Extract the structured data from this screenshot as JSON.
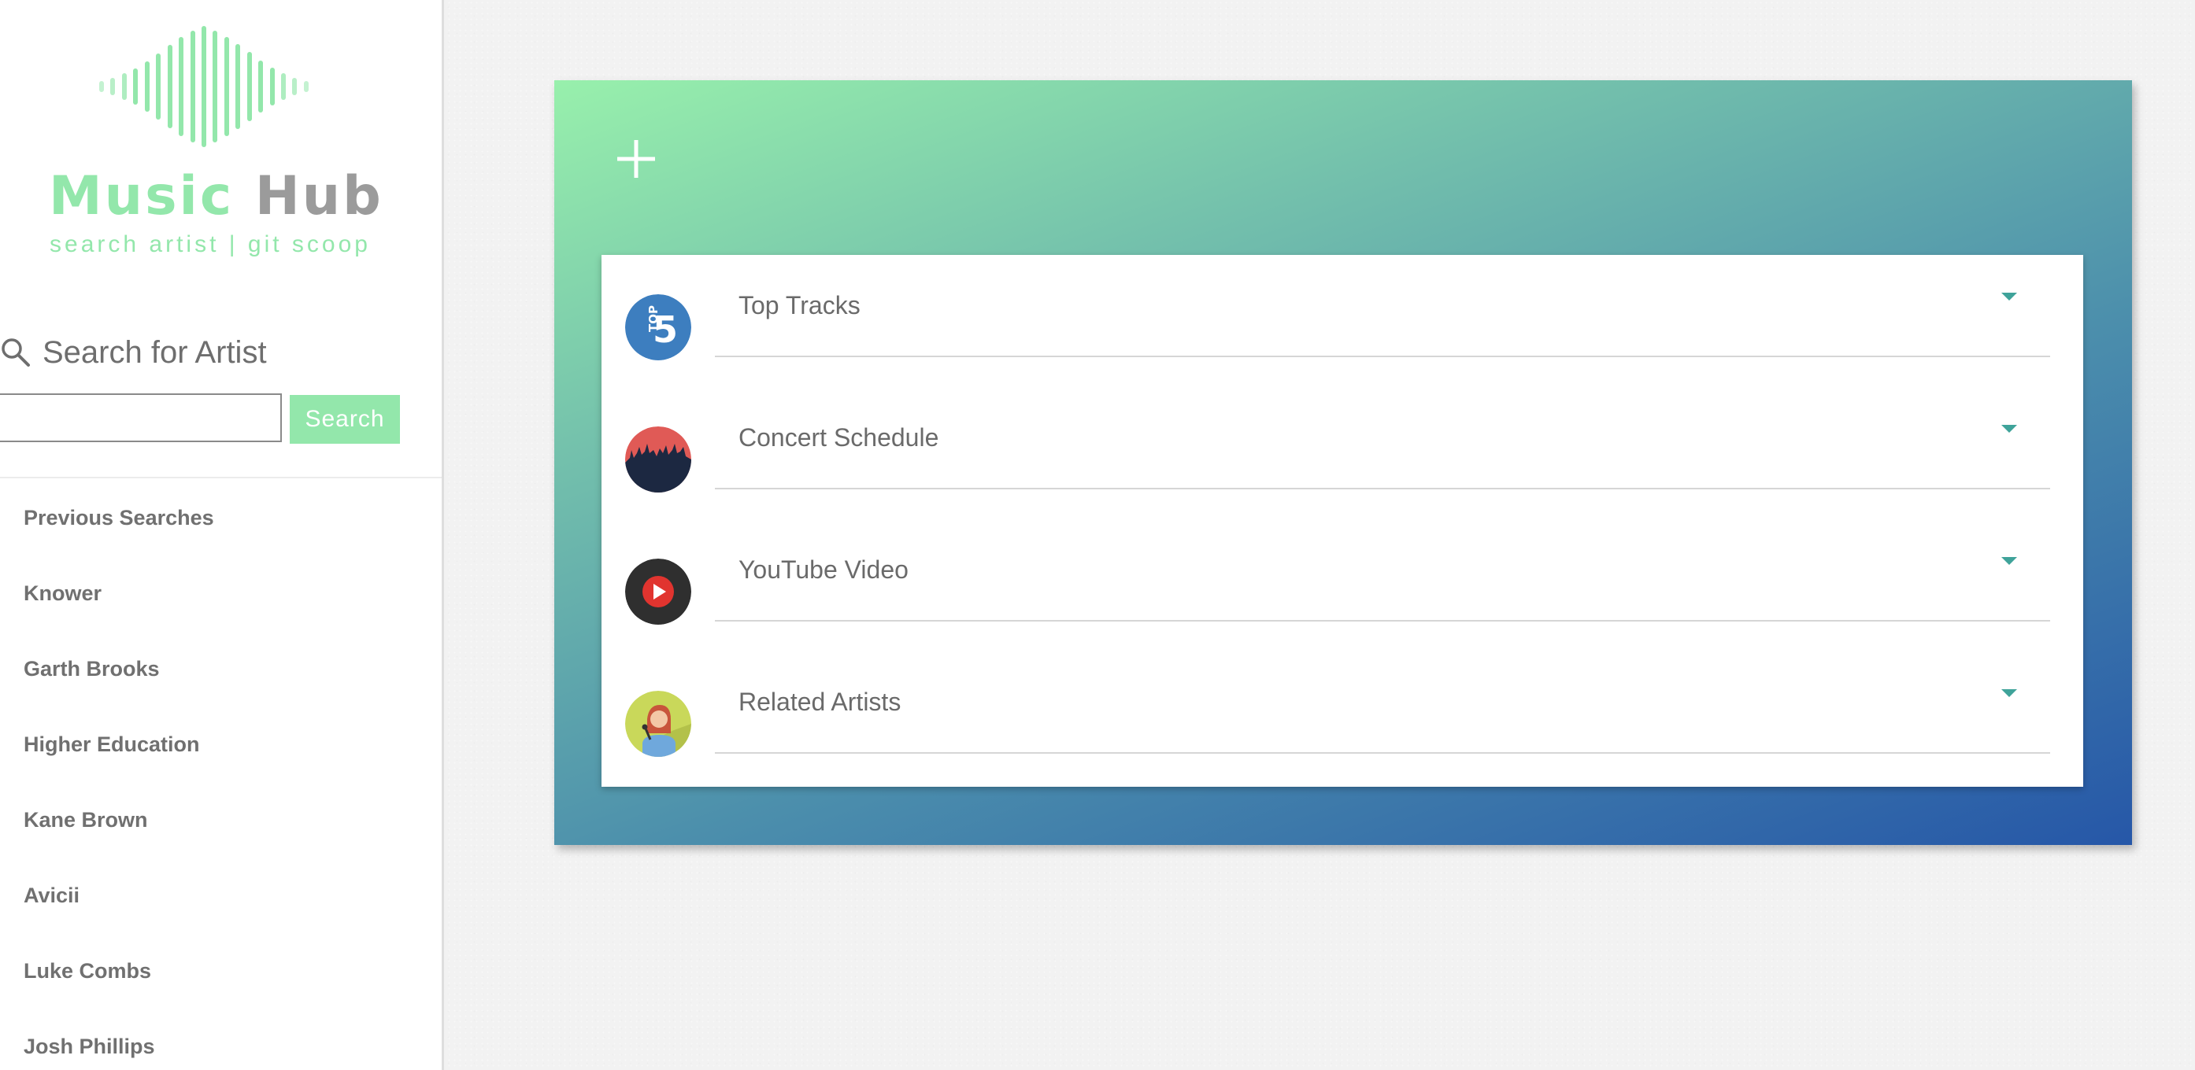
{
  "colors": {
    "brand_green": "#93e7ab",
    "brand_gray": "#9b9b9b",
    "caret_teal": "#3fa39a",
    "gradient_start": "#98f0ac",
    "gradient_end": "#2657a8"
  },
  "logo": {
    "word1": "Music",
    "word2": "Hub",
    "tagline": "search artist | git scoop"
  },
  "search": {
    "heading": "Search for Artist",
    "input_value": "",
    "button_label": "Search"
  },
  "previous": {
    "heading": "Previous Searches",
    "items": [
      "Knower",
      "Garth Brooks",
      "Higher Education",
      "Kane Brown",
      "Avicii",
      "Luke Combs",
      "Josh Phillips"
    ]
  },
  "card": {
    "add_icon": "plus-icon",
    "sections": [
      {
        "label": "Top Tracks",
        "icon": "top5-icon"
      },
      {
        "label": "Concert Schedule",
        "icon": "concert-crowd-icon"
      },
      {
        "label": "YouTube Video",
        "icon": "youtube-play-icon"
      },
      {
        "label": "Related Artists",
        "icon": "singer-icon"
      }
    ]
  }
}
